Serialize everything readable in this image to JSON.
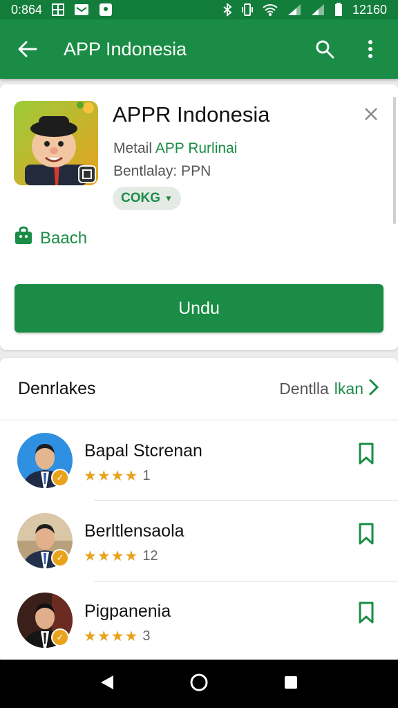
{
  "status_bar": {
    "time_left": "0:864",
    "time_right": "12160"
  },
  "app_bar": {
    "title": "APP Indonesia"
  },
  "app": {
    "name": "APPR Indonesia",
    "meta_prefix": "Metail",
    "meta_link": "APP Rurlinai",
    "meta_line2": "Bentlalay: PPN",
    "chip_label": "COKG",
    "tag_label": "Baach",
    "install_label": "Undu"
  },
  "section": {
    "title": "Denrlakes",
    "link_prefix": "Dentlla",
    "link_green": "lkan"
  },
  "items": [
    {
      "name": "Bapal Stcrenan",
      "stars": "★★★★",
      "count": "1"
    },
    {
      "name": "Berltlensaola",
      "stars": "★★★★",
      "count": "12"
    },
    {
      "name": "Pigpanenia",
      "stars": "★★★★",
      "count": "3"
    }
  ],
  "colors": {
    "primary": "#1a8c45",
    "status": "#137d3b",
    "star": "#e9a21b"
  }
}
